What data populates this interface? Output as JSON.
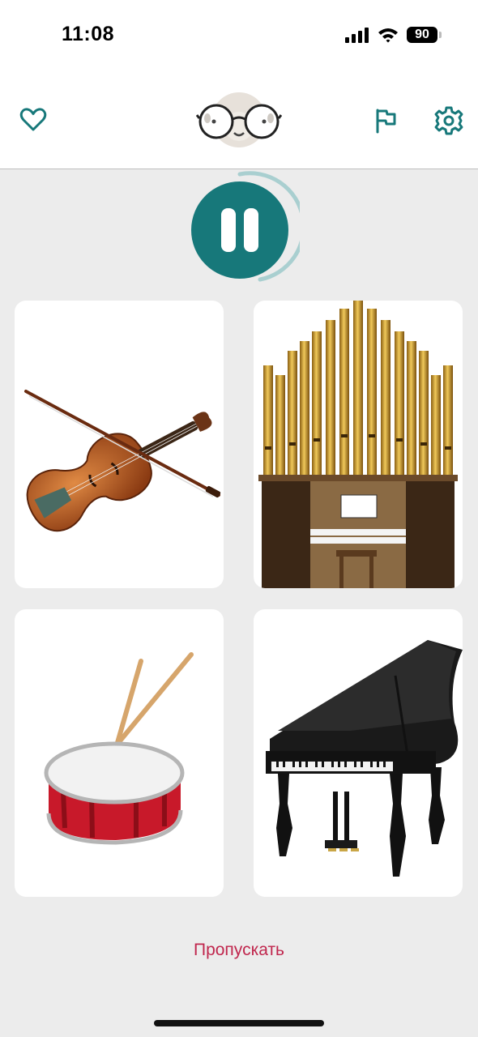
{
  "status_bar": {
    "time": "11:08",
    "battery_level": "90",
    "icons": [
      "cellular-signal-icon",
      "wifi-icon",
      "battery-icon"
    ]
  },
  "header": {
    "left_icon": "heart-icon",
    "center": "owl-avatar",
    "right_icons": [
      "flag-icon",
      "gear-icon"
    ]
  },
  "player": {
    "state_icon": "pause-icon"
  },
  "answers": [
    {
      "id": "violin",
      "picture": "violin-with-bow"
    },
    {
      "id": "organ",
      "picture": "pipe-organ"
    },
    {
      "id": "drum",
      "picture": "snare-drum-with-sticks"
    },
    {
      "id": "piano",
      "picture": "grand-piano"
    }
  ],
  "skip_label": "Пропускать",
  "colors": {
    "accent": "#17787a",
    "skip_text": "#c0264d",
    "background": "#ececec",
    "card": "#ffffff"
  }
}
